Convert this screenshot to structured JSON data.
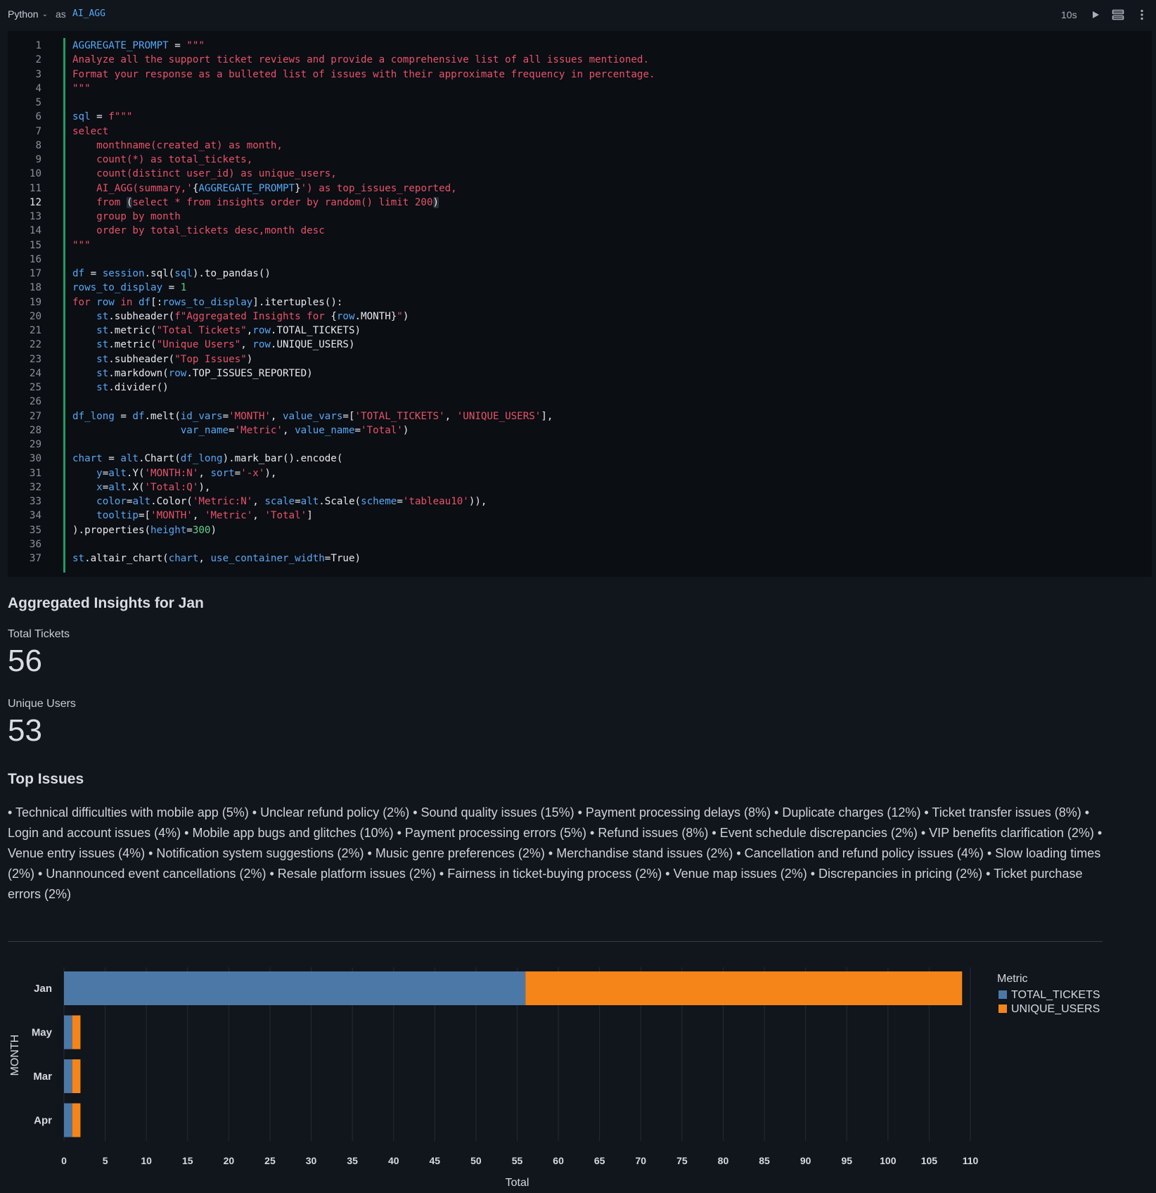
{
  "header": {
    "language": "Python",
    "as_label": "as",
    "cell_name": "AI_AGG",
    "run_time": "10s",
    "icons": [
      "chevron-down-icon",
      "play-icon",
      "stack-icon",
      "more-vertical-icon"
    ]
  },
  "code": {
    "active_line": 12,
    "lines": [
      [
        [
          "v",
          "AGGREGATE_PROMPT"
        ],
        [
          "p",
          " = "
        ],
        [
          "s",
          "\"\"\""
        ]
      ],
      [
        [
          "s",
          "Analyze all the support ticket reviews and provide a comprehensive list of all issues mentioned."
        ]
      ],
      [
        [
          "s",
          "Format your response as a bulleted list of issues with their approximate frequency in percentage."
        ]
      ],
      [
        [
          "s",
          "\"\"\""
        ]
      ],
      [],
      [
        [
          "v",
          "sql"
        ],
        [
          "p",
          " = "
        ],
        [
          "s",
          "f\"\"\""
        ]
      ],
      [
        [
          "k",
          "select"
        ]
      ],
      [
        [
          "s",
          "    monthname(created_at) as month,"
        ]
      ],
      [
        [
          "s",
          "    count(*) as total_tickets,"
        ]
      ],
      [
        [
          "s",
          "    count(distinct user_id) as unique_users,"
        ]
      ],
      [
        [
          "s",
          "    AI_AGG(summary,'"
        ],
        [
          "p",
          "{"
        ],
        [
          "v",
          "AGGREGATE_PROMPT"
        ],
        [
          "p",
          "}"
        ],
        [
          "s",
          "') as top_issues_reported,"
        ]
      ],
      [
        [
          "s",
          "    from "
        ],
        [
          "h",
          "("
        ],
        [
          "s",
          "select * from insights order by random() limit 200"
        ],
        [
          "h",
          ")"
        ]
      ],
      [
        [
          "s",
          "    group by month"
        ]
      ],
      [
        [
          "s",
          "    order by total_tickets desc,month desc"
        ]
      ],
      [
        [
          "s",
          "\"\"\""
        ]
      ],
      [],
      [
        [
          "v",
          "df"
        ],
        [
          "p",
          " = "
        ],
        [
          "v",
          "session"
        ],
        [
          "p",
          ".sql("
        ],
        [
          "v",
          "sql"
        ],
        [
          "p",
          ").to_pandas()"
        ]
      ],
      [
        [
          "v",
          "rows_to_display"
        ],
        [
          "p",
          " = "
        ],
        [
          "n",
          "1"
        ]
      ],
      [
        [
          "k",
          "for"
        ],
        [
          "p",
          " "
        ],
        [
          "v",
          "row"
        ],
        [
          "p",
          " "
        ],
        [
          "k",
          "in"
        ],
        [
          "p",
          " "
        ],
        [
          "v",
          "df"
        ],
        [
          "p",
          "[:"
        ],
        [
          "v",
          "rows_to_display"
        ],
        [
          "p",
          "].itertuples():"
        ]
      ],
      [
        [
          "p",
          "    "
        ],
        [
          "v",
          "st"
        ],
        [
          "p",
          ".subheader("
        ],
        [
          "s",
          "f\"Aggregated Insights for "
        ],
        [
          "p",
          "{"
        ],
        [
          "v",
          "row"
        ],
        [
          "p",
          ".MONTH}"
        ],
        [
          "s",
          "\""
        ],
        [
          "p",
          ")"
        ]
      ],
      [
        [
          "p",
          "    "
        ],
        [
          "v",
          "st"
        ],
        [
          "p",
          ".metric("
        ],
        [
          "s",
          "\"Total Tickets\""
        ],
        [
          "p",
          ","
        ],
        [
          "v",
          "row"
        ],
        [
          "p",
          ".TOTAL_TICKETS)"
        ]
      ],
      [
        [
          "p",
          "    "
        ],
        [
          "v",
          "st"
        ],
        [
          "p",
          ".metric("
        ],
        [
          "s",
          "\"Unique Users\""
        ],
        [
          "p",
          ", "
        ],
        [
          "v",
          "row"
        ],
        [
          "p",
          ".UNIQUE_USERS)"
        ]
      ],
      [
        [
          "p",
          "    "
        ],
        [
          "v",
          "st"
        ],
        [
          "p",
          ".subheader("
        ],
        [
          "s",
          "\"Top Issues\""
        ],
        [
          "p",
          ")"
        ]
      ],
      [
        [
          "p",
          "    "
        ],
        [
          "v",
          "st"
        ],
        [
          "p",
          ".markdown("
        ],
        [
          "v",
          "row"
        ],
        [
          "p",
          ".TOP_ISSUES_REPORTED)"
        ]
      ],
      [
        [
          "p",
          "    "
        ],
        [
          "v",
          "st"
        ],
        [
          "p",
          ".divider()"
        ]
      ],
      [],
      [
        [
          "v",
          "df_long"
        ],
        [
          "p",
          " = "
        ],
        [
          "v",
          "df"
        ],
        [
          "p",
          ".melt("
        ],
        [
          "v",
          "id_vars"
        ],
        [
          "p",
          "="
        ],
        [
          "s",
          "'MONTH'"
        ],
        [
          "p",
          ", "
        ],
        [
          "v",
          "value_vars"
        ],
        [
          "p",
          "=["
        ],
        [
          "s",
          "'TOTAL_TICKETS'"
        ],
        [
          "p",
          ", "
        ],
        [
          "s",
          "'UNIQUE_USERS'"
        ],
        [
          "p",
          "],"
        ]
      ],
      [
        [
          "p",
          "                  "
        ],
        [
          "v",
          "var_name"
        ],
        [
          "p",
          "="
        ],
        [
          "s",
          "'Metric'"
        ],
        [
          "p",
          ", "
        ],
        [
          "v",
          "value_name"
        ],
        [
          "p",
          "="
        ],
        [
          "s",
          "'Total'"
        ],
        [
          "p",
          ")"
        ]
      ],
      [],
      [
        [
          "v",
          "chart"
        ],
        [
          "p",
          " = "
        ],
        [
          "v",
          "alt"
        ],
        [
          "p",
          ".Chart("
        ],
        [
          "v",
          "df_long"
        ],
        [
          "p",
          ").mark_bar().encode("
        ]
      ],
      [
        [
          "p",
          "    "
        ],
        [
          "v",
          "y"
        ],
        [
          "p",
          "="
        ],
        [
          "v",
          "alt"
        ],
        [
          "p",
          ".Y("
        ],
        [
          "s",
          "'MONTH:N'"
        ],
        [
          "p",
          ", "
        ],
        [
          "v",
          "sort"
        ],
        [
          "p",
          "="
        ],
        [
          "s",
          "'-x'"
        ],
        [
          "p",
          "),"
        ]
      ],
      [
        [
          "p",
          "    "
        ],
        [
          "v",
          "x"
        ],
        [
          "p",
          "="
        ],
        [
          "v",
          "alt"
        ],
        [
          "p",
          ".X("
        ],
        [
          "s",
          "'Total:Q'"
        ],
        [
          "p",
          "),"
        ]
      ],
      [
        [
          "p",
          "    "
        ],
        [
          "v",
          "color"
        ],
        [
          "p",
          "="
        ],
        [
          "v",
          "alt"
        ],
        [
          "p",
          ".Color("
        ],
        [
          "s",
          "'Metric:N'"
        ],
        [
          "p",
          ", "
        ],
        [
          "v",
          "scale"
        ],
        [
          "p",
          "="
        ],
        [
          "v",
          "alt"
        ],
        [
          "p",
          ".Scale("
        ],
        [
          "v",
          "scheme"
        ],
        [
          "p",
          "="
        ],
        [
          "s",
          "'tableau10'"
        ],
        [
          "p",
          ")),"
        ]
      ],
      [
        [
          "p",
          "    "
        ],
        [
          "v",
          "tooltip"
        ],
        [
          "p",
          "=["
        ],
        [
          "s",
          "'MONTH'"
        ],
        [
          "p",
          ", "
        ],
        [
          "s",
          "'Metric'"
        ],
        [
          "p",
          ", "
        ],
        [
          "s",
          "'Total'"
        ],
        [
          "p",
          "]"
        ]
      ],
      [
        [
          "p",
          ").properties("
        ],
        [
          "v",
          "height"
        ],
        [
          "p",
          "="
        ],
        [
          "n",
          "300"
        ],
        [
          "p",
          ")"
        ]
      ],
      [],
      [
        [
          "v",
          "st"
        ],
        [
          "p",
          ".altair_chart("
        ],
        [
          "v",
          "chart"
        ],
        [
          "p",
          ", "
        ],
        [
          "v",
          "use_container_width"
        ],
        [
          "p",
          "=True)"
        ]
      ]
    ]
  },
  "output": {
    "subheader": "Aggregated Insights for Jan",
    "metrics": [
      {
        "label": "Total Tickets",
        "value": "56"
      },
      {
        "label": "Unique Users",
        "value": "53"
      }
    ],
    "top_issues_title": "Top Issues",
    "top_issues_text": "• Technical difficulties with mobile app (5%) • Unclear refund policy (2%) • Sound quality issues (15%) • Payment processing delays (8%) • Duplicate charges (12%) • Ticket transfer issues (8%) • Login and account issues (4%) • Mobile app bugs and glitches (10%) • Payment processing errors (5%) • Refund issues (8%) • Event schedule discrepancies (2%) • VIP benefits clarification (2%) • Venue entry issues (4%) • Notification system suggestions (2%) • Music genre preferences (2%) • Merchandise stand issues (2%) • Cancellation and refund policy issues (4%) • Slow loading times (2%) • Unannounced event cancellations (2%) • Resale platform issues (2%) • Fairness in ticket-buying process (2%) • Venue map issues (2%) • Discrepancies in pricing (2%) • Ticket purchase errors (2%)"
  },
  "chart_data": {
    "type": "bar",
    "orientation": "horizontal",
    "stacked": true,
    "categories": [
      "Jan",
      "May",
      "Mar",
      "Apr"
    ],
    "series": [
      {
        "name": "TOTAL_TICKETS",
        "values": [
          56,
          1,
          1,
          1
        ],
        "color": "#4c78a8"
      },
      {
        "name": "UNIQUE_USERS",
        "values": [
          53,
          1,
          1,
          1
        ],
        "color": "#f58518"
      }
    ],
    "xlabel": "Total",
    "ylabel": "MONTH",
    "xlim": [
      0,
      110
    ],
    "xticks": [
      0,
      5,
      10,
      15,
      20,
      25,
      30,
      35,
      40,
      45,
      50,
      55,
      60,
      65,
      70,
      75,
      80,
      85,
      90,
      95,
      100,
      105,
      110
    ],
    "legend_title": "Metric",
    "legend_position": "right",
    "grid": true
  }
}
